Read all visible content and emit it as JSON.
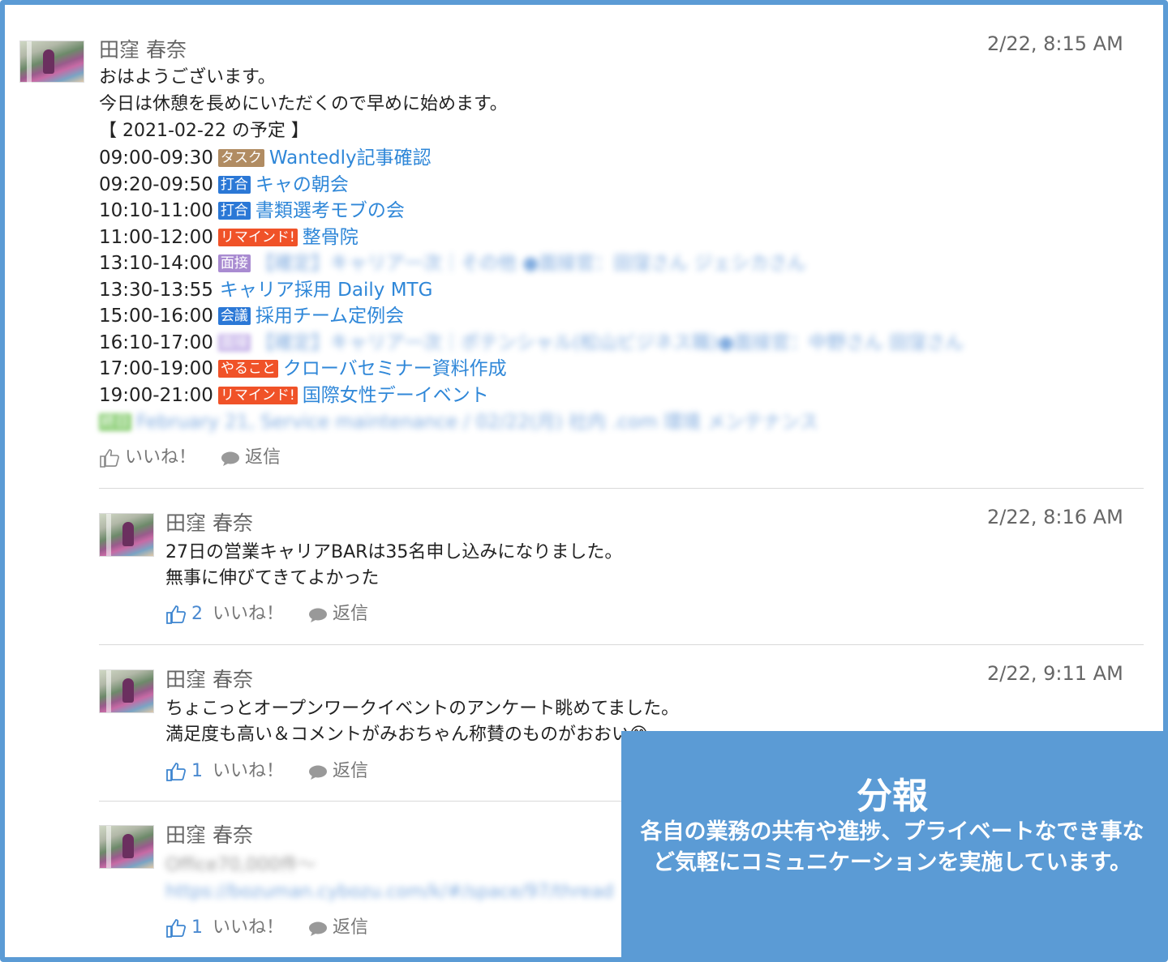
{
  "overlay": {
    "title": "分報",
    "description": "各自の業務の共有や進捗、プライベートなでき事など気軽にコミュニケーションを実施しています。"
  },
  "actions": {
    "like_label": "いいね！",
    "reply_label": "返信"
  },
  "posts": [
    {
      "author": "田窪 春奈",
      "time": "2/22, 8:15 AM",
      "lines": [
        "おはようございます。",
        "今日は休憩を長めにいただくので早めに始めます。",
        "【 2021-02-22 の予定 】"
      ],
      "schedule": [
        {
          "time": "09:00-09:30",
          "badge": "タスク",
          "title": "Wantedly記事確認"
        },
        {
          "time": "09:20-09:50",
          "badge": "打合",
          "title": "キャの朝会"
        },
        {
          "time": "10:10-11:00",
          "badge": "打合",
          "title": "書類選考モブの会"
        },
        {
          "time": "11:00-12:00",
          "badge": "リマインド!",
          "title": "整骨院"
        },
        {
          "time": "13:10-14:00",
          "badge": "面接",
          "title": "【確定】キャリア一次｜その他 ●面接官：田窪さん ジェシカさん"
        },
        {
          "time": "13:30-13:55",
          "badge": "",
          "title": "キャリア採用 Daily MTG"
        },
        {
          "time": "15:00-16:00",
          "badge": "会議",
          "title": "採用チーム定例会"
        },
        {
          "time": "16:10-17:00",
          "badge": "面接",
          "title": "【確定】キャリア一次｜ポテンシャル(松山ビジネス職)●面接官：中野さん 田窪さん"
        },
        {
          "time": "17:00-19:00",
          "badge": "やること",
          "title": "クローバセミナー資料作成"
        },
        {
          "time": "19:00-21:00",
          "badge": "リマインド!",
          "title": "国際女性デーイベント"
        }
      ],
      "footer_line": {
        "badge": "終日",
        "text": "February 21, Service maintenance / 02/22(月) 社内 .com 環境 メンテナンス"
      },
      "likes": ""
    },
    {
      "author": "田窪 春奈",
      "time": "2/22, 8:16 AM",
      "lines": [
        "27日の営業キャリアBARは35名申し込みになりました。",
        "無事に伸びてきてよかった"
      ],
      "likes": "2"
    },
    {
      "author": "田窪 春奈",
      "time": "2/22, 9:11 AM",
      "lines": [
        "ちょこっとオープンワークイベントのアンケート眺めてました。",
        "満足度も高い＆コメントがみおちゃん称賛のものがおおい😊"
      ],
      "likes": "1"
    },
    {
      "author": "田窪 春奈",
      "time": "",
      "lines": [
        "Office70,000件〜",
        "https://bozuman.cybozu.com/k/#/space/97/thread"
      ],
      "likes": "1"
    }
  ],
  "colors": {
    "frame": "#5b9bd5",
    "link": "#2f87d8",
    "badge_task": "#b18c62",
    "badge_meeting": "#2b78d6",
    "badge_remind": "#f05228",
    "badge_interview": "#a98bd1"
  },
  "icons": [
    "thumbs-up-icon",
    "speech-bubble-icon"
  ]
}
